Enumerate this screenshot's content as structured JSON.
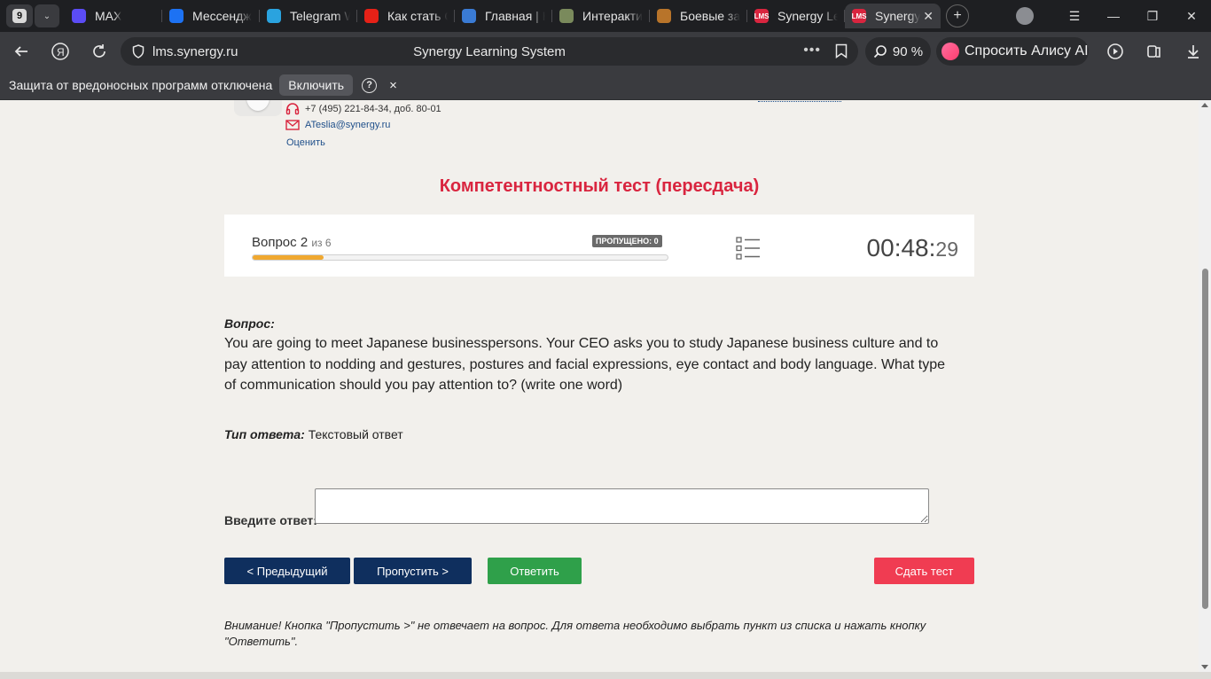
{
  "browser": {
    "tab_count": "9",
    "tabs": [
      {
        "title": "MAX",
        "favicon_color": "#5b4cf5",
        "favicon": "max-icon"
      },
      {
        "title": "Мессендж",
        "favicon_color": "#1d72f3",
        "favicon": "messenger-icon"
      },
      {
        "title": "Telegram W",
        "favicon_color": "#2aa3df",
        "favicon": "telegram-icon"
      },
      {
        "title": "Как стать С",
        "favicon_color": "#e62117",
        "favicon": "youtube-icon"
      },
      {
        "title": "Главная | Н",
        "favicon_color": "#3a7bd5",
        "favicon": "robot-icon"
      },
      {
        "title": "Интеракти",
        "favicon_color": "#7a8a5c",
        "favicon": "globe-icon"
      },
      {
        "title": "Боевые за",
        "favicon_color": "#b8742a",
        "favicon": "game-icon"
      },
      {
        "title": "Synergy Le",
        "favicon_color": "#d9253f",
        "favicon": "lms-icon",
        "favicon_text": "LMS"
      },
      {
        "title": "Synergy",
        "favicon_color": "#d9253f",
        "favicon": "lms-icon",
        "favicon_text": "LMS",
        "active": true
      }
    ],
    "url": "lms.synergy.ru",
    "page_title": "Synergy Learning System",
    "zoom": "90 %",
    "alice_label": "Спросить Алису AI",
    "infobar": {
      "message": "Защита от вредоносных программ отключена",
      "enable_label": "Включить",
      "help": "?",
      "close": "×"
    }
  },
  "contact": {
    "phone": "+7 (495) 221-84-34, доб. 80-01",
    "email": "ATeslia@synergy.ru",
    "rate_label": "Оценить"
  },
  "test": {
    "title": "Компетентностный тест (пересдача)",
    "question_label": "Вопрос 2",
    "question_of": "из 6",
    "skipped_badge": "ПРОПУЩЕНО: 0",
    "progress_fraction": 0.17,
    "timer_main": "00:48:",
    "timer_seconds": "29"
  },
  "question": {
    "heading": "Вопрос:",
    "text": "You are going to meet Japanese businesspersons. Your CEO asks you to study Japanese business culture and to pay attention to nodding and gestures, postures and facial expressions, eye contact and body language. What type of communication should you pay attention to? (write one word)",
    "answer_type_label": "Тип ответа:",
    "answer_type_value": "Текстовый ответ",
    "answer_input_label": "Введите ответ:",
    "answer_value": ""
  },
  "buttons": {
    "prev": "< Предыдущий",
    "skip": "Пропустить >",
    "answer": "Ответить",
    "finish": "Сдать тест"
  },
  "notice": "Внимание! Кнопка \"Пропустить >\" не отвечает на вопрос. Для ответа необходимо выбрать пункт из списка и нажать кнопку \"Ответить\".",
  "colors": {
    "accent_red": "#d9253f",
    "nav_blue": "#0f2f5e",
    "answer_green": "#2fa04a",
    "finish_red": "#f03c52",
    "progress_orange": "#f0a830"
  }
}
